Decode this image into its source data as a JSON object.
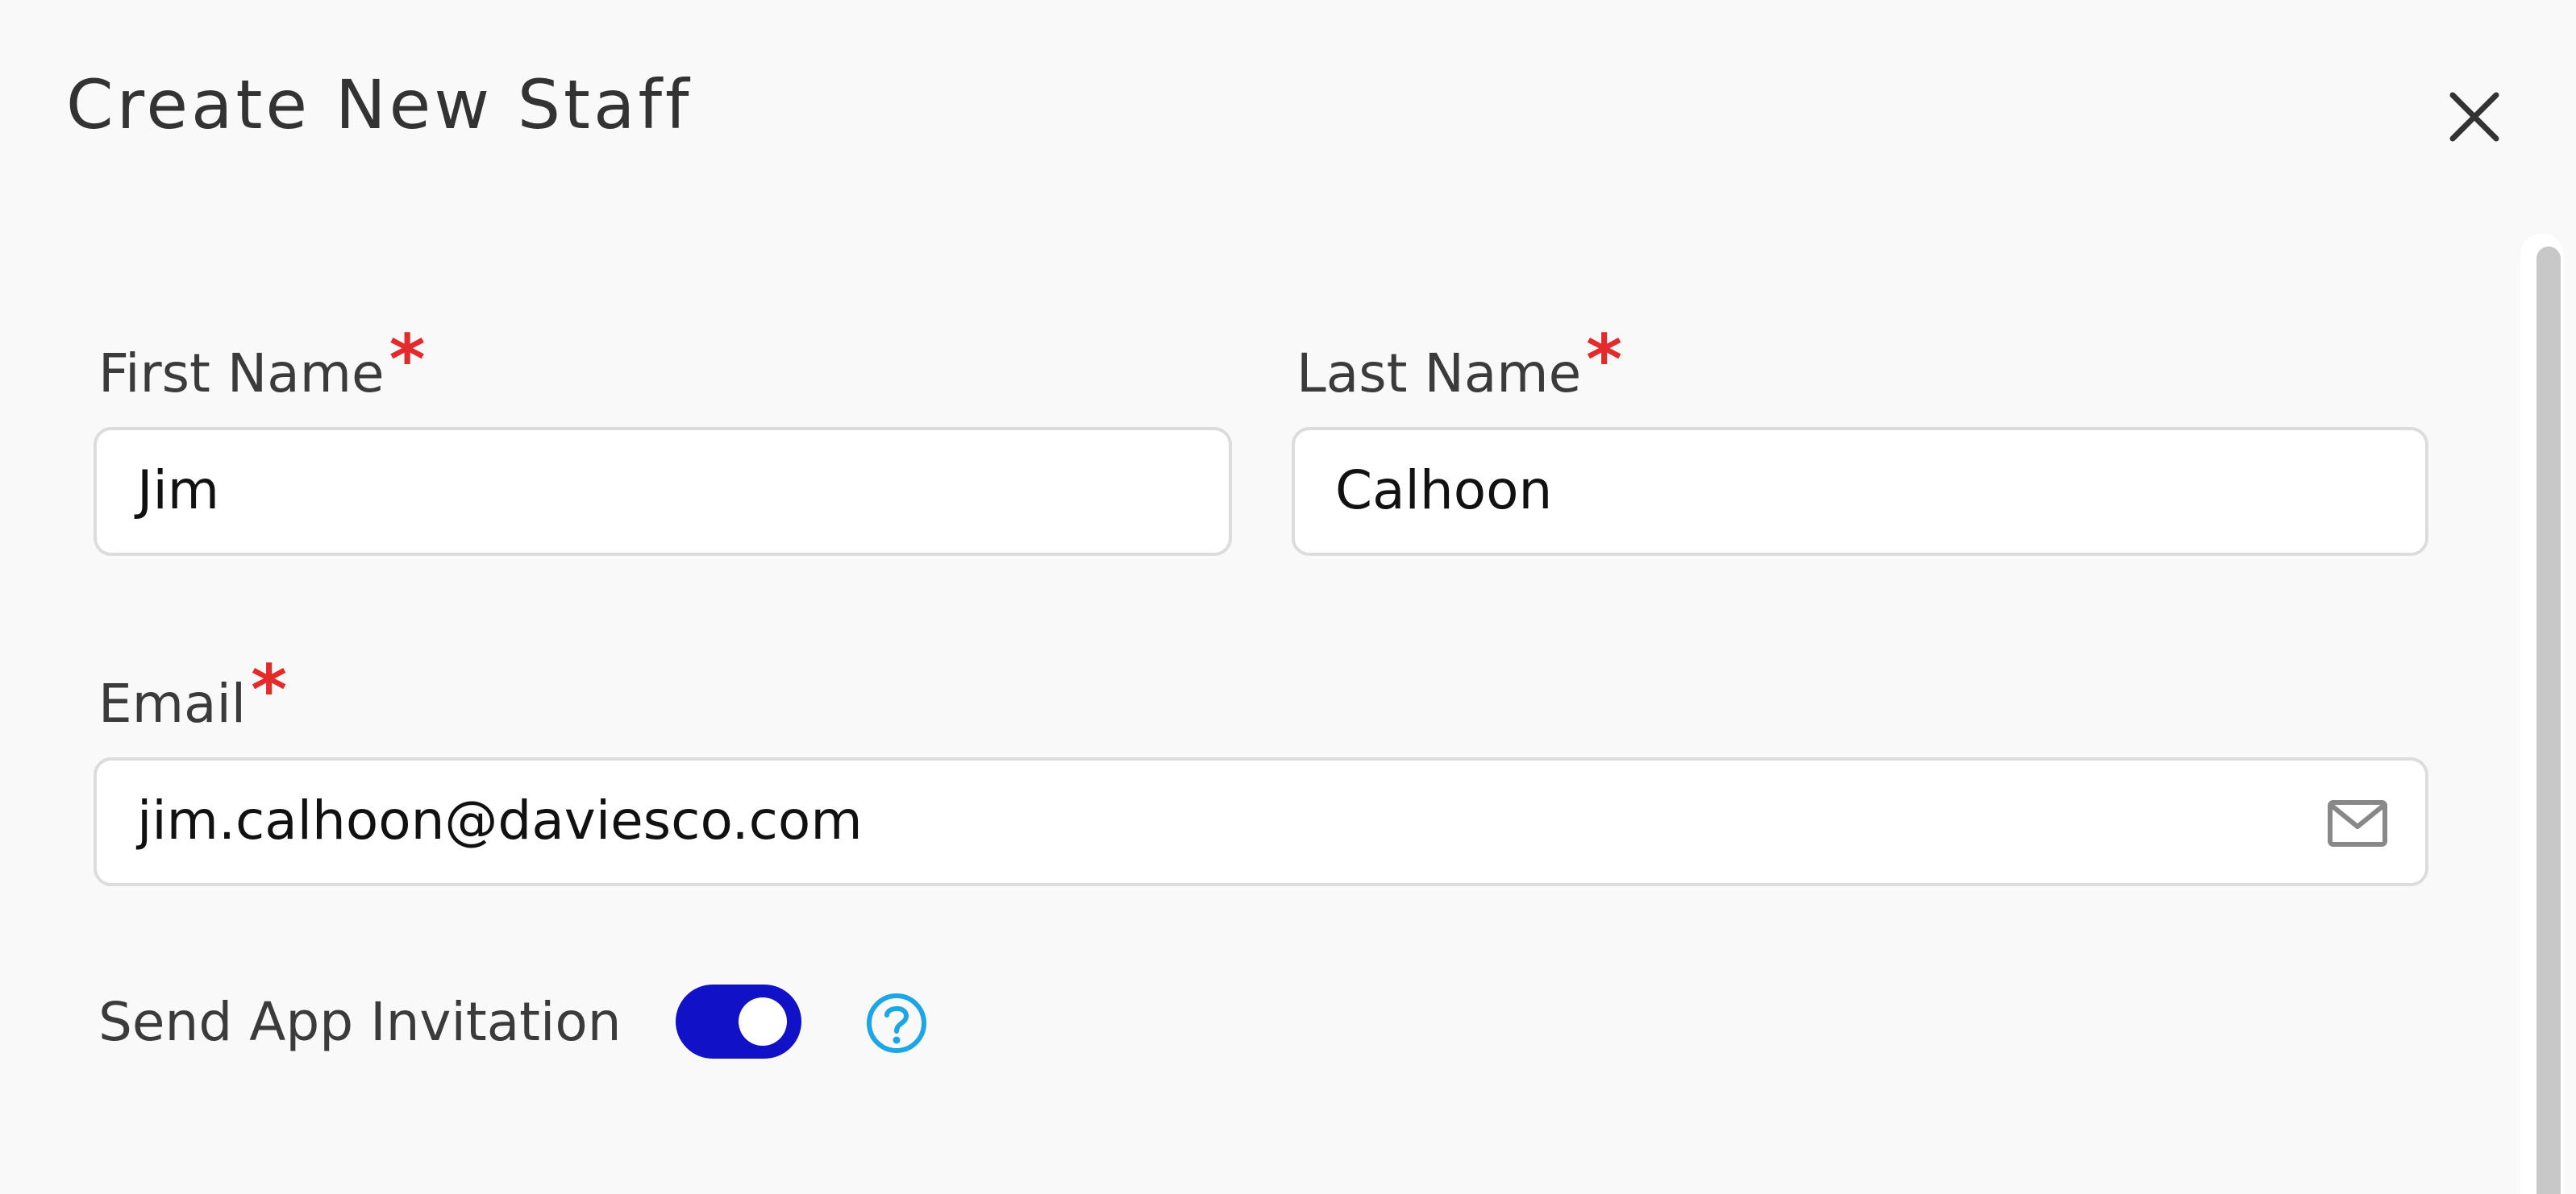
{
  "dialog": {
    "title": "Create New Staff",
    "close_icon": "close-icon"
  },
  "form": {
    "first_name": {
      "label": "First Name",
      "required_mark": "*",
      "value": "Jim"
    },
    "last_name": {
      "label": "Last Name",
      "required_mark": "*",
      "value": "Calhoon"
    },
    "email": {
      "label": "Email",
      "required_mark": "*",
      "value": "jim.calhoon@daviesco.com",
      "icon": "mail-icon"
    },
    "send_app_invitation": {
      "label": "Send App Invitation",
      "enabled": true,
      "help_icon": "help-icon"
    }
  },
  "colors": {
    "background": "#f9f9f9",
    "required": "#e32b2b",
    "toggle_on": "#1111c8",
    "help": "#1ca6e8"
  }
}
